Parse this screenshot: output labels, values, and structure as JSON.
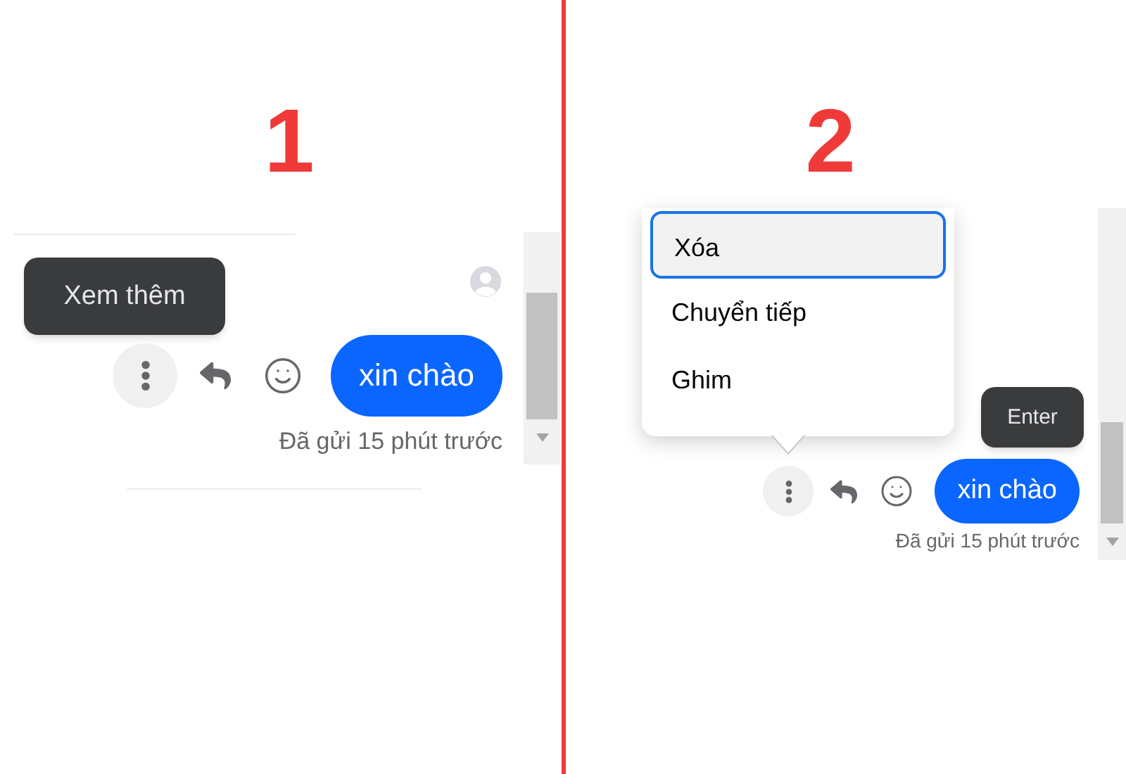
{
  "panels": [
    {
      "step": "1",
      "tooltip": {
        "text": "Xem thêm"
      },
      "message": "xin chào",
      "sent": "Đã gửi 15 phút trước"
    },
    {
      "step": "2",
      "menu": {
        "items": [
          {
            "label": "Xóa",
            "selected": true
          },
          {
            "label": "Chuyển tiếp",
            "selected": false
          },
          {
            "label": "Ghim",
            "selected": false
          }
        ]
      },
      "tooltip": {
        "text": "Enter"
      },
      "message": "xin chào",
      "sent": "Đã gửi 15 phút trước"
    }
  ]
}
